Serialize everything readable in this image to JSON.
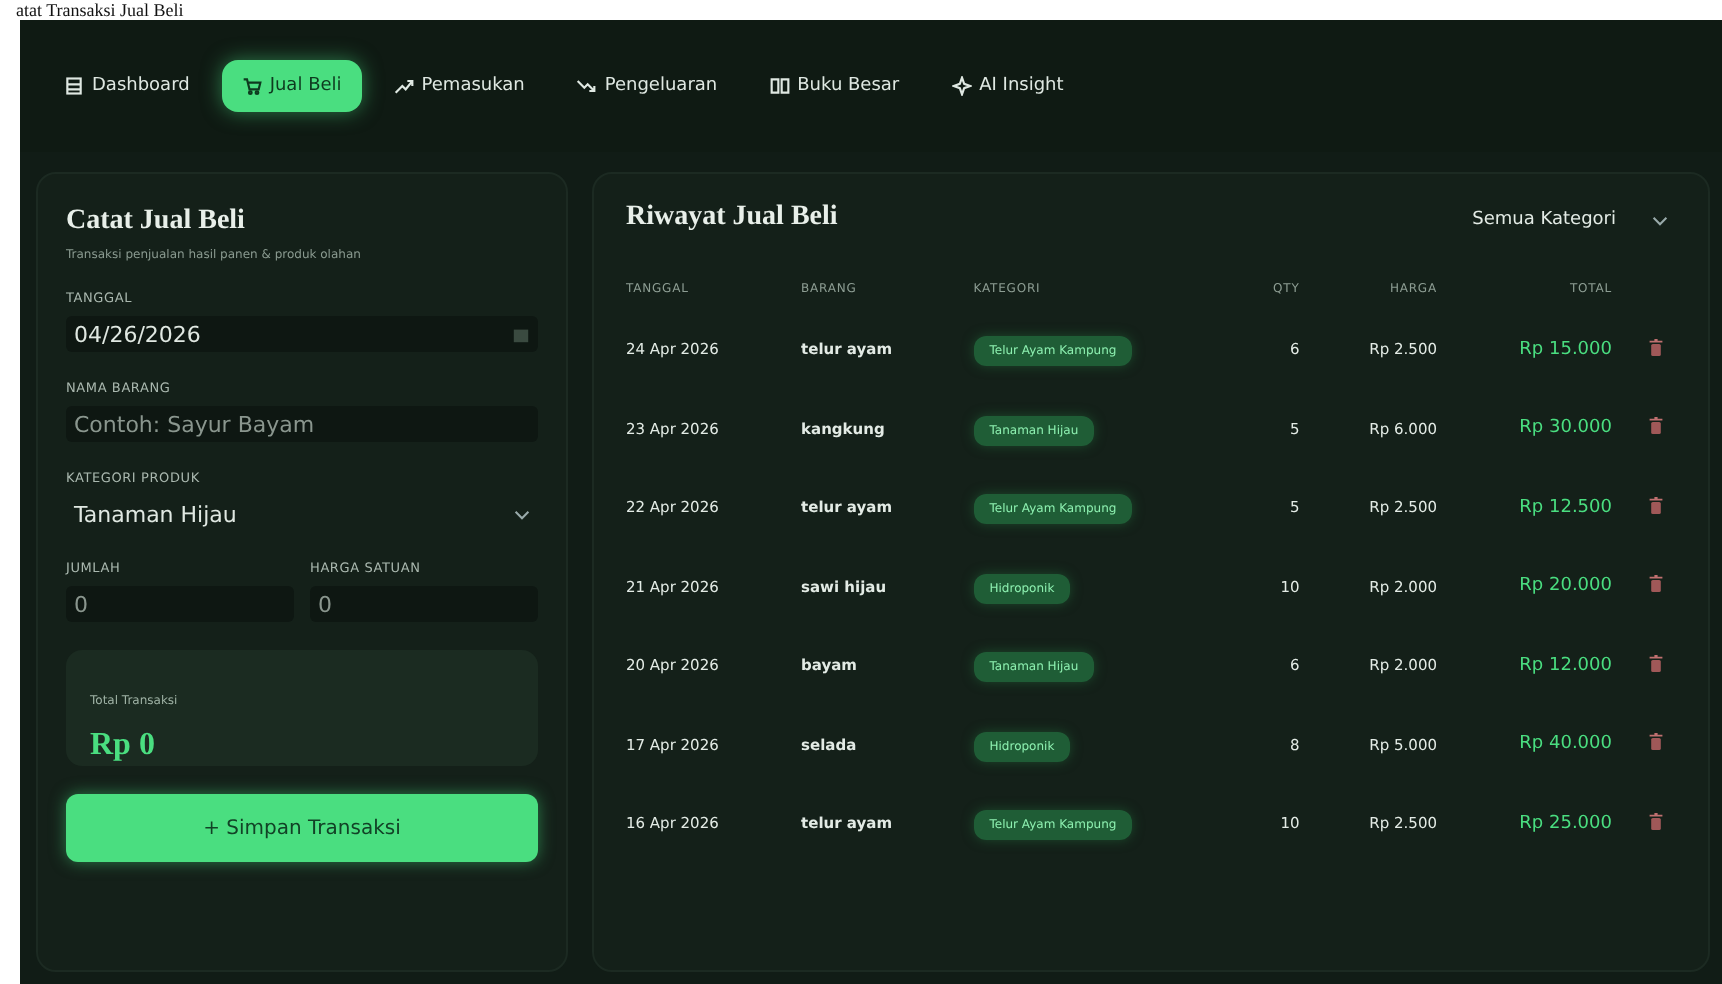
{
  "page_title": "atat Transaksi Jual Beli",
  "nav": [
    {
      "label": "Dashboard",
      "selected": false
    },
    {
      "label": "Jual Beli",
      "selected": true
    },
    {
      "label": "Pemasukan",
      "selected": false
    },
    {
      "label": "Pengeluaran",
      "selected": false
    },
    {
      "label": "Buku Besar",
      "selected": false
    },
    {
      "label": "AI Insight",
      "selected": false
    }
  ],
  "form": {
    "title": "Catat Jual Beli",
    "subtitle": "Transaksi penjualan hasil panen & produk olahan",
    "date_label": "TANGGAL",
    "date_value": "04/26/2026",
    "name_label": "NAMA BARANG",
    "name_placeholder": "Contoh: Sayur Bayam",
    "category_label": "KATEGORI PRODUK",
    "category_value": "Tanaman Hijau",
    "qty_label": "JUMLAH",
    "qty_placeholder": "0",
    "price_label": "HARGA SATUAN",
    "price_placeholder": "0",
    "total_label": "Total Transaksi",
    "total_value": "Rp 0",
    "submit": "+ Simpan Transaksi"
  },
  "history": {
    "title": "Riwayat Jual Beli",
    "filter": "Semua Kategori",
    "columns": [
      "TANGGAL",
      "BARANG",
      "KATEGORI",
      "QTY",
      "HARGA",
      "TOTAL"
    ],
    "rows": [
      {
        "date": "24 Apr 2026",
        "item": "telur ayam",
        "category": "Telur Ayam Kampung",
        "qty": "6",
        "price": "Rp 2.500",
        "total": "Rp 15.000"
      },
      {
        "date": "23 Apr 2026",
        "item": "kangkung",
        "category": "Tanaman Hijau",
        "qty": "5",
        "price": "Rp 6.000",
        "total": "Rp 30.000"
      },
      {
        "date": "22 Apr 2026",
        "item": "telur ayam",
        "category": "Telur Ayam Kampung",
        "qty": "5",
        "price": "Rp 2.500",
        "total": "Rp 12.500"
      },
      {
        "date": "21 Apr 2026",
        "item": "sawi hijau",
        "category": "Hidroponik",
        "qty": "10",
        "price": "Rp 2.000",
        "total": "Rp 20.000"
      },
      {
        "date": "20 Apr 2026",
        "item": "bayam",
        "category": "Tanaman Hijau",
        "qty": "6",
        "price": "Rp 2.000",
        "total": "Rp 12.000"
      },
      {
        "date": "17 Apr 2026",
        "item": "selada",
        "category": "Hidroponik",
        "qty": "8",
        "price": "Rp 5.000",
        "total": "Rp 40.000"
      },
      {
        "date": "16 Apr 2026",
        "item": "telur ayam",
        "category": "Telur Ayam Kampung",
        "qty": "10",
        "price": "Rp 2.500",
        "total": "Rp 25.000"
      }
    ]
  }
}
